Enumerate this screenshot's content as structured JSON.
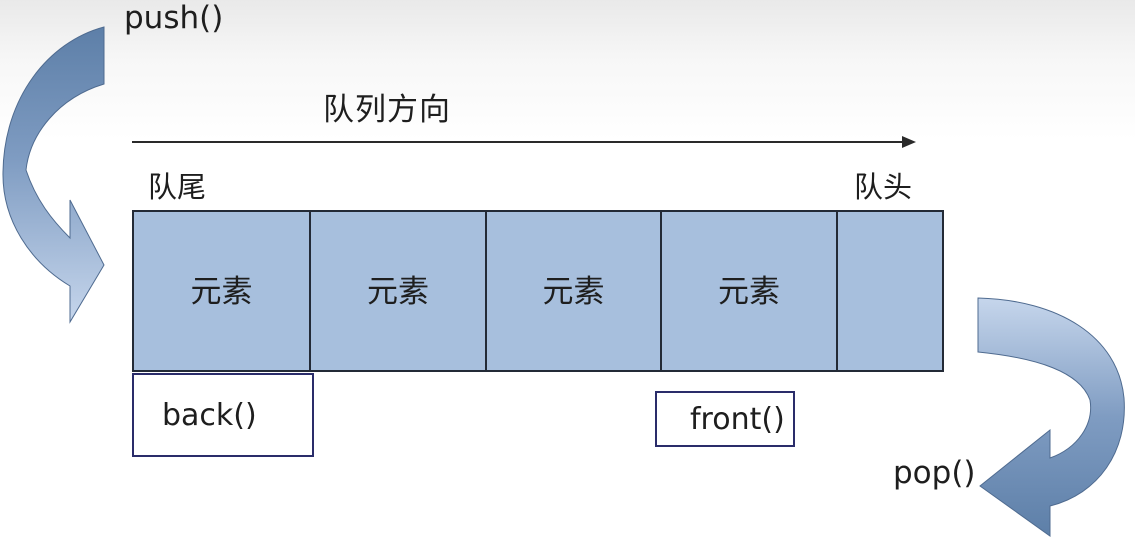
{
  "diagram": {
    "title": "队列方向",
    "push_label": "push()",
    "pop_label": "pop()",
    "tail_label": "队尾",
    "head_label": "队头",
    "cells": [
      "元素",
      "元素",
      "元素",
      "元素",
      ""
    ],
    "back_label": "back()",
    "front_label": "front()"
  },
  "colors": {
    "cell_fill": "#a7bfdd",
    "border": "#232a36",
    "tag_border": "#2a2c6a",
    "arrow_fill_top": "#5d7fa8",
    "arrow_fill_bottom": "#c6d6ec"
  },
  "icons": {
    "push": "curved-arrow-down-icon",
    "pop": "curved-arrow-down-left-icon",
    "direction": "arrow-right-icon"
  }
}
